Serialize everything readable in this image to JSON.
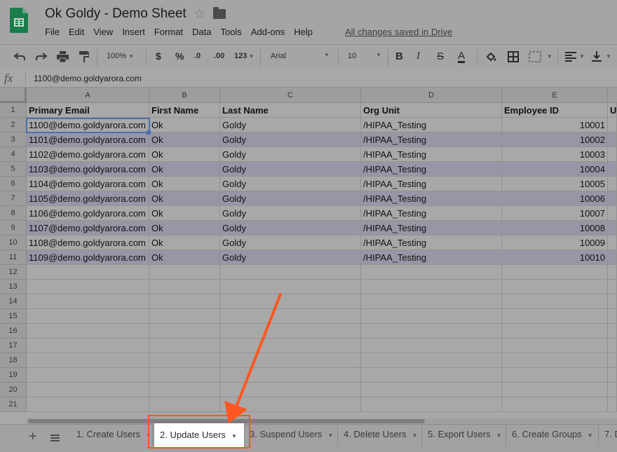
{
  "app": {
    "title": "Ok Goldy - Demo Sheet",
    "status": "All changes saved in Drive",
    "brand_color": "#0f9d58"
  },
  "menu": [
    "File",
    "Edit",
    "View",
    "Insert",
    "Format",
    "Data",
    "Tools",
    "Add-ons",
    "Help"
  ],
  "toolbar": {
    "undo_icon": "undo-icon",
    "redo_icon": "redo-icon",
    "print_icon": "print-icon",
    "paint_format_icon": "paint-format-icon",
    "zoom": "100%",
    "currency": "$",
    "percent": "%",
    "decrease_decimal": ".0",
    "increase_decimal": ".00",
    "more_formats": "123",
    "font": "Arial",
    "font_size": "10",
    "bold": "B",
    "italic": "I",
    "strikethrough": "S",
    "text_color": "A"
  },
  "formula_bar": {
    "label": "fx",
    "value": "1100@demo.goldyarora.com"
  },
  "columns": [
    "A",
    "B",
    "C",
    "D",
    "E"
  ],
  "row_numbers": [
    "1",
    "2",
    "3",
    "4",
    "5",
    "6",
    "7",
    "8",
    "9",
    "10",
    "11",
    "12",
    "13",
    "14",
    "15",
    "16",
    "17",
    "18",
    "19",
    "20",
    "21"
  ],
  "headers": [
    "Primary Email",
    "First Name",
    "Last Name",
    "Org Unit",
    "Employee ID",
    "U"
  ],
  "rows": [
    [
      "1100@demo.goldyarora.com",
      "Ok",
      "Goldy",
      "/HIPAA_Testing",
      "10001"
    ],
    [
      "1101@demo.goldyarora.com",
      "Ok",
      "Goldy",
      "/HIPAA_Testing",
      "10002"
    ],
    [
      "1102@demo.goldyarora.com",
      "Ok",
      "Goldy",
      "/HIPAA_Testing",
      "10003"
    ],
    [
      "1103@demo.goldyarora.com",
      "Ok",
      "Goldy",
      "/HIPAA_Testing",
      "10004"
    ],
    [
      "1104@demo.goldyarora.com",
      "Ok",
      "Goldy",
      "/HIPAA_Testing",
      "10005"
    ],
    [
      "1105@demo.goldyarora.com",
      "Ok",
      "Goldy",
      "/HIPAA_Testing",
      "10006"
    ],
    [
      "1106@demo.goldyarora.com",
      "Ok",
      "Goldy",
      "/HIPAA_Testing",
      "10007"
    ],
    [
      "1107@demo.goldyarora.com",
      "Ok",
      "Goldy",
      "/HIPAA_Testing",
      "10008"
    ],
    [
      "1108@demo.goldyarora.com",
      "Ok",
      "Goldy",
      "/HIPAA_Testing",
      "10009"
    ],
    [
      "1109@demo.goldyarora.com",
      "Ok",
      "Goldy",
      "/HIPAA_Testing",
      "10010"
    ]
  ],
  "sheets": [
    {
      "label": "1. Create Users",
      "active": false
    },
    {
      "label": "2. Update Users",
      "active": true
    },
    {
      "label": "3. Suspend Users",
      "active": false
    },
    {
      "label": "4. Delete Users",
      "active": false
    },
    {
      "label": "5. Export Users",
      "active": false
    },
    {
      "label": "6. Create Groups",
      "active": false
    },
    {
      "label": "7. D",
      "active": false
    }
  ],
  "annotation": {
    "arrow_color": "#ff5722"
  }
}
